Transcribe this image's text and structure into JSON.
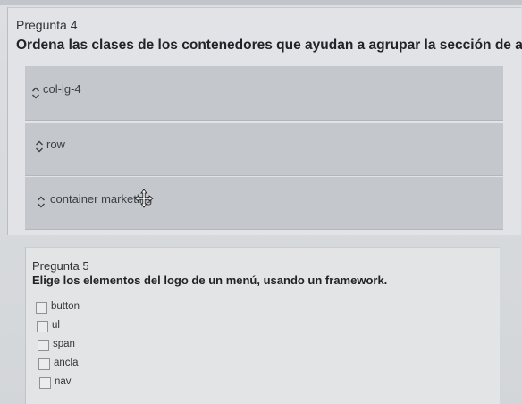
{
  "question4": {
    "number_label": "Pregunta 4",
    "prompt": "Ordena las clases de los contenedores que ayudan a agrupar la sección de artículos.",
    "items": [
      {
        "label": "col-lg-4",
        "icon": "up-down-arrows-icon"
      },
      {
        "label": "row",
        "icon": "up-down-arrows-icon"
      },
      {
        "label": "container marketing",
        "icon": "up-down-arrows-icon",
        "drag_icon": "move-cursor-icon"
      }
    ]
  },
  "question5": {
    "number_label": "Pregunta 5",
    "prompt": "Elige los elementos del logo de un menú, usando un framework.",
    "options": [
      {
        "label": "button",
        "checked": false
      },
      {
        "label": "ul",
        "checked": false
      },
      {
        "label": "span",
        "checked": false
      },
      {
        "label": "ancla",
        "checked": false
      },
      {
        "label": "nav",
        "checked": false
      }
    ]
  },
  "colors": {
    "page_background": "#d7d9dc",
    "order_item_background": "#c4c7cc",
    "title_text": "#202327"
  }
}
